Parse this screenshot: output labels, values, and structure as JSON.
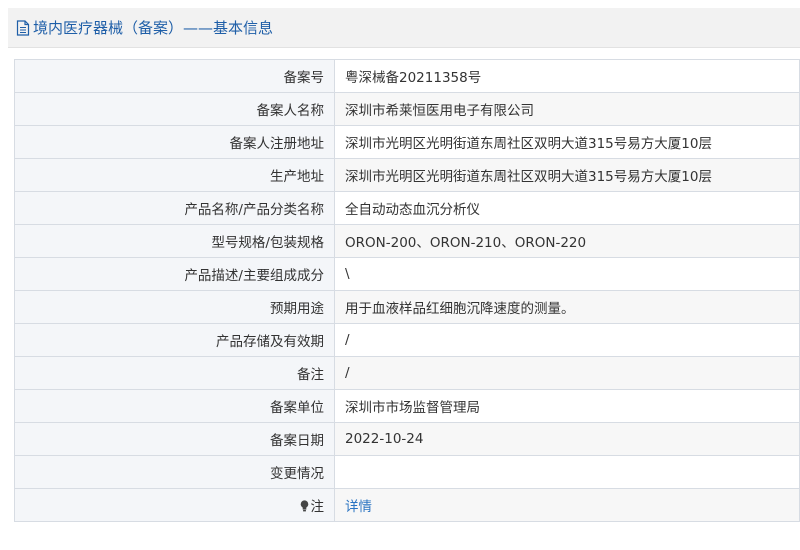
{
  "header": {
    "title": "境内医疗器械（备案）——基本信息",
    "icon": "document-icon",
    "title_color": "#1f5fa8"
  },
  "rows": [
    {
      "label": "备案号",
      "value": "粤深械备20211358号"
    },
    {
      "label": "备案人名称",
      "value": "深圳市希莱恒医用电子有限公司"
    },
    {
      "label": "备案人注册地址",
      "value": "深圳市光明区光明街道东周社区双明大道315号易方大厦10层"
    },
    {
      "label": "生产地址",
      "value": "深圳市光明区光明街道东周社区双明大道315号易方大厦10层"
    },
    {
      "label": "产品名称/产品分类名称",
      "value": "全自动动态血沉分析仪"
    },
    {
      "label": "型号规格/包装规格",
      "value": "ORON-200、ORON-210、ORON-220"
    },
    {
      "label": "产品描述/主要组成成分",
      "value": "\\"
    },
    {
      "label": "预期用途",
      "value": "用于血液样品红细胞沉降速度的测量。"
    },
    {
      "label": "产品存储及有效期",
      "value": "/"
    },
    {
      "label": "备注",
      "value": "/"
    },
    {
      "label": "备案单位",
      "value": "深圳市市场监督管理局"
    },
    {
      "label": "备案日期",
      "value": "2022-10-24"
    },
    {
      "label": "变更情况",
      "value": ""
    }
  ],
  "note": {
    "icon": "lightbulb-icon",
    "label": "注",
    "link_text": "详情",
    "link_color": "#2a74c2"
  }
}
